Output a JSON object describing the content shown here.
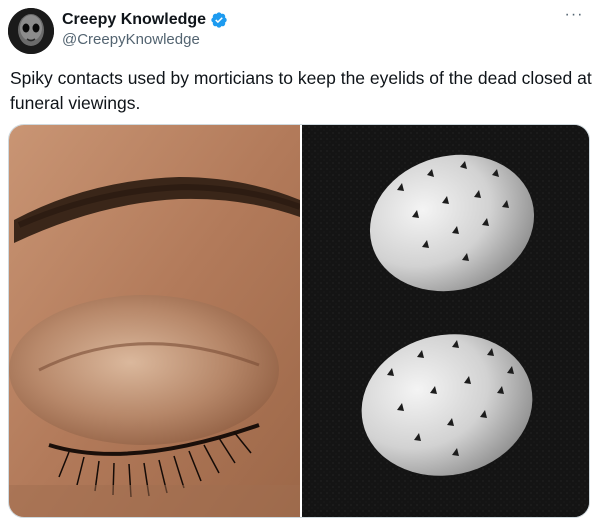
{
  "author": {
    "display_name": "Creepy Knowledge",
    "handle": "@CreepyKnowledge",
    "verified": true,
    "avatar_icon": "skull-face-avatar"
  },
  "tweet": {
    "text": "Spiky contacts used by morticians to keep the eyelids of the dead closed at funeral viewings."
  },
  "more_menu": {
    "label": "···"
  },
  "media": {
    "images": [
      {
        "icon": "closed-eye-photo"
      },
      {
        "icon": "spiky-eye-caps-photo"
      }
    ]
  },
  "colors": {
    "text": "#0f1419",
    "secondary_text": "#536471",
    "verified_blue": "#1d9bf0",
    "border": "#cfd9de"
  }
}
